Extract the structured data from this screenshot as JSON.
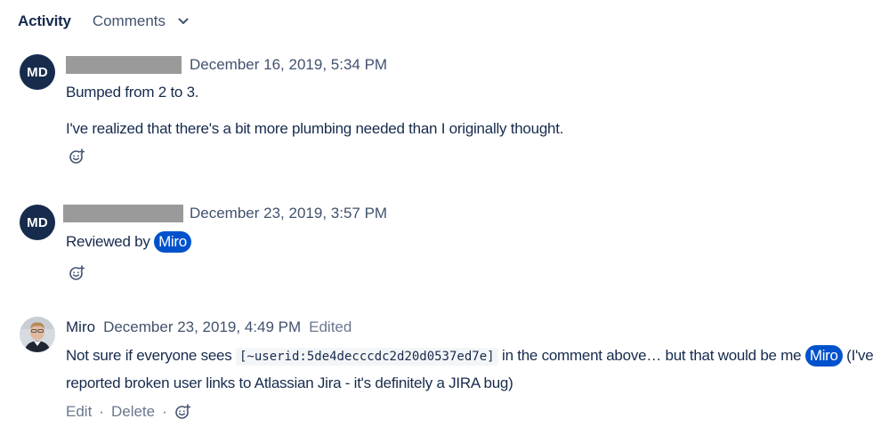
{
  "tabs": {
    "activity_label": "Activity",
    "comments_label": "Comments"
  },
  "comments": [
    {
      "avatar_initials": "MD",
      "date": "December 16, 2019, 5:34 PM",
      "paragraphs": [
        "Bumped from 2 to 3.",
        "I've realized that there's a bit more plumbing needed than I originally thought."
      ]
    },
    {
      "avatar_initials": "MD",
      "date": "December 23, 2019, 3:57 PM",
      "text_before_mention": "Reviewed by ",
      "mention": "Miro"
    },
    {
      "author": "Miro",
      "date": "December 23, 2019, 4:49 PM",
      "edited_label": "Edited",
      "line1_before_code": "Not sure if everyone sees ",
      "code": "[~userid:5de4decccdc2d20d0537ed7e]",
      "line1_after_code": " in the comment above… but that would be me ",
      "mention": "Miro",
      "line1_tail": " (I've",
      "line2": "reported broken user links to Atlassian Jira - it's definitely a JIRA bug)",
      "actions": {
        "edit_label": "Edit",
        "delete_label": "Delete",
        "separator": "·"
      }
    }
  ],
  "colors": {
    "avatar_bg": "#172b4d",
    "mention_bg": "#0052cc",
    "text_primary": "#172b4d",
    "text_secondary": "#42526e",
    "text_subtle": "#6b778c",
    "redaction": "#9a9a9a"
  },
  "icons": {
    "reaction": "add-reaction-icon",
    "tab_dropdown": "chevron-down-icon"
  }
}
